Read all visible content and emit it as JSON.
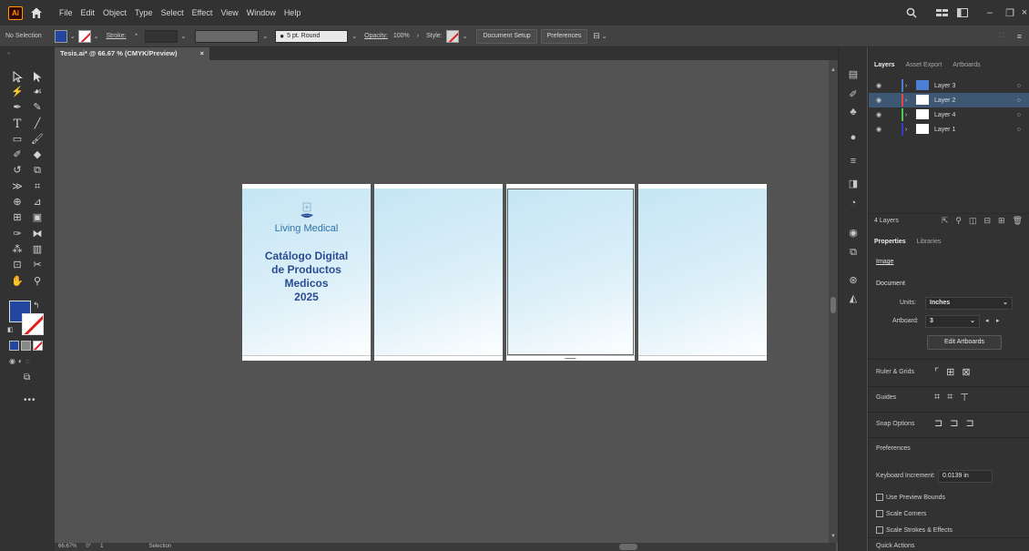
{
  "menubar": {
    "logo": "Ai",
    "menus": [
      "File",
      "Edit",
      "Object",
      "Type",
      "Select",
      "Effect",
      "View",
      "Window",
      "Help"
    ]
  },
  "controlbar": {
    "selection": "No Selection",
    "stroke_label": "Stroke:",
    "brush": "5 pt. Round",
    "opacity_label": "Opacity:",
    "opacity_value": "100%",
    "style_label": "Style:",
    "document_setup": "Document Setup",
    "preferences": "Preferences"
  },
  "document": {
    "tab_title": "Tesis.ai* @ 66.67 % (CMYK/Preview)",
    "close": "×"
  },
  "artboard1": {
    "brand": "Living Medical",
    "lines": [
      "Catálogo Digital",
      "de Productos",
      "Medicos",
      "2025"
    ]
  },
  "status": {
    "zoom": "66.67%",
    "angle": "0°",
    "artboard": "1",
    "tool": "Selection"
  },
  "layers_panel": {
    "tabs": [
      "Layers",
      "Asset Export",
      "Artboards"
    ],
    "layers": [
      {
        "name": "Layer 3",
        "color": "#4a7fd4"
      },
      {
        "name": "Layer 2",
        "color": "#e8463c"
      },
      {
        "name": "Layer 4",
        "color": "#4fc94f"
      },
      {
        "name": "Layer 1",
        "color": "#3a3ac8"
      }
    ],
    "count": "4 Layers"
  },
  "properties": {
    "tabs": [
      "Properties",
      "Libraries"
    ],
    "image": "Image",
    "document": "Document",
    "units_label": "Units:",
    "units_value": "Inches",
    "artboard_label": "Artboard:",
    "artboard_value": "3",
    "edit_artboards": "Edit Artboards",
    "ruler_grids": "Ruler & Grids",
    "guides": "Guides",
    "snap_options": "Snap Options",
    "preferences": "Preferences",
    "keyboard_label": "Keyboard Increment:",
    "keyboard_value": "0.0139 in",
    "use_preview_bounds": "Use Preview Bounds",
    "scale_corners": "Scale Corners",
    "scale_strokes": "Scale Strokes & Effects",
    "quick_actions": "Quick Actions"
  },
  "colors": {
    "fill": "#2346a0",
    "accent_selected": "#3e5874",
    "brand_text": "#2f73a8",
    "title_text": "#2a4c92"
  }
}
